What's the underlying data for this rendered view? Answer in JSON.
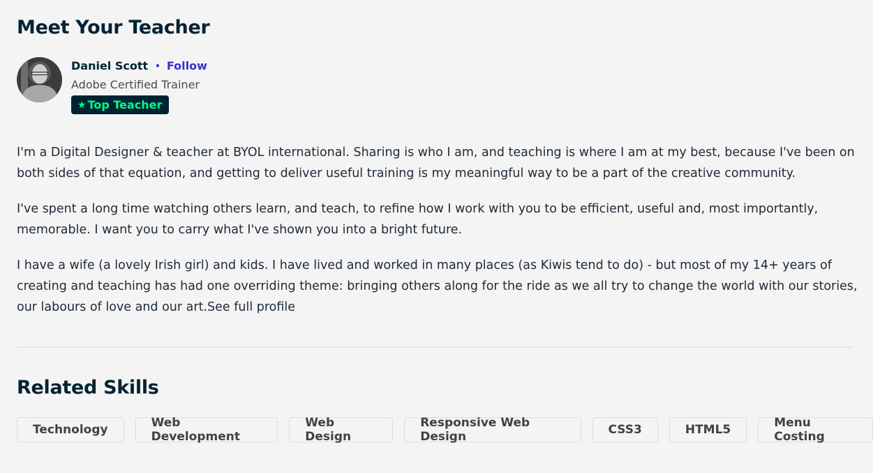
{
  "meet_teacher": {
    "title": "Meet Your Teacher",
    "teacher": {
      "name": "Daniel Scott",
      "separator": "•",
      "follow_label": "Follow",
      "subtitle": "Adobe Certified Trainer",
      "badge": {
        "icon": "star-icon",
        "star_glyph": "★",
        "label": "Top Teacher"
      }
    },
    "bio": [
      "I'm a Digital Designer & teacher at BYOL international. Sharing is who I am, and teaching is where I am at my best, because I've been on both sides of that equation, and getting to deliver useful training is my meaningful way to be a part of the creative community.",
      "I've spent a long time watching others learn, and teach, to refine how I work with you to be efficient, useful and, most importantly, memorable. I want you to carry what I've shown you into a bright future.",
      "I have a wife (a lovely Irish girl) and kids. I have lived and worked in many places (as Kiwis tend to do) - but most of my 14+ years of creating and teaching has had one overriding theme: bringing others along for the ride as we all try to change the world with our stories, our labours of love and our art."
    ],
    "see_full_profile": "See full profile"
  },
  "related_skills": {
    "title": "Related Skills",
    "skills": [
      "Technology",
      "Web Development",
      "Web Design",
      "Responsive Web Design",
      "CSS3",
      "HTML5",
      "Menu Costing"
    ]
  },
  "colors": {
    "background": "#f4f4f4",
    "heading": "#002333",
    "link": "#3b2fd1",
    "badge_bg": "#002333",
    "badge_text": "#00ff84"
  }
}
